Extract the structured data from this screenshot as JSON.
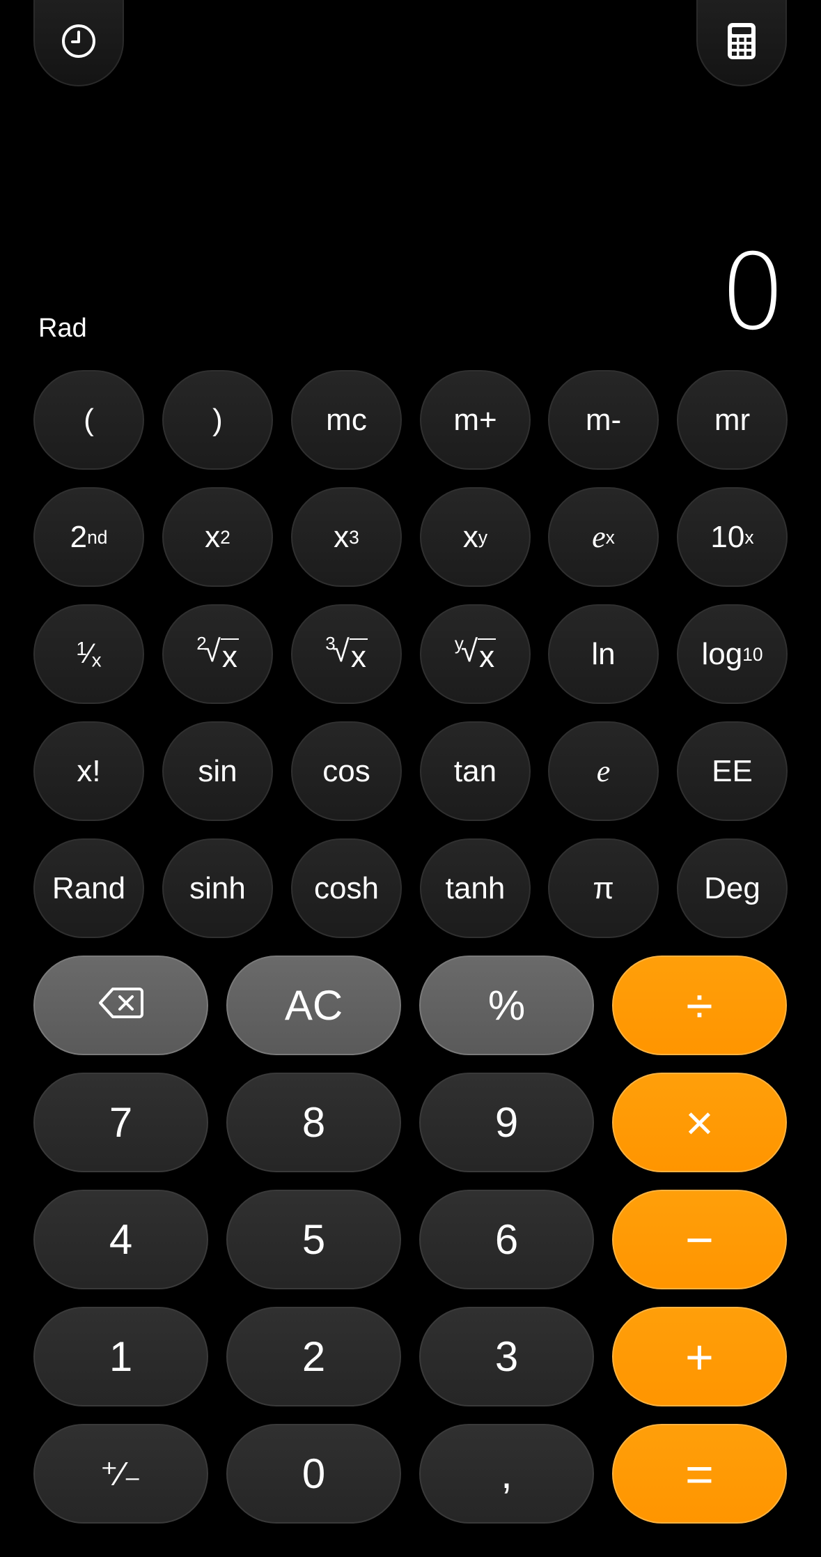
{
  "display": {
    "value": "0",
    "angle_mode": "Rad"
  },
  "top": {
    "history_icon": "clock-icon",
    "mode_icon": "calculator-icon"
  },
  "scientific": {
    "row1": [
      "(",
      ")",
      "mc",
      "m+",
      "m-",
      "mr"
    ],
    "row2": {
      "second": "2",
      "second_sup": "nd",
      "x": "x",
      "x2_sup": "2",
      "x3_sup": "3",
      "xy_sup": "y",
      "e": "e",
      "ex_sup": "x",
      "ten": "10",
      "tenx_sup": "x"
    },
    "row3": {
      "reciprocal": "⅟",
      "reciprocal_x": "x",
      "sqrt2_idx": "2",
      "sqrt3_idx": "3",
      "sqrty_idx": "y",
      "radicand": "x",
      "ln": "ln",
      "log": "log",
      "log_sub": "10"
    },
    "row4": [
      "x!",
      "sin",
      "cos",
      "tan",
      "e",
      "EE"
    ],
    "row5": [
      "Rand",
      "sinh",
      "cosh",
      "tanh",
      "π",
      "Deg"
    ]
  },
  "standard": {
    "backspace_icon": "backspace-icon",
    "ac": "AC",
    "percent": "%",
    "divide": "÷",
    "digits": [
      "7",
      "8",
      "9",
      "4",
      "5",
      "6",
      "1",
      "2",
      "3"
    ],
    "multiply": "×",
    "minus": "−",
    "plus": "+",
    "plus_minus": "⁺∕₋",
    "zero": "0",
    "decimal": ",",
    "equals": "="
  },
  "colors": {
    "operator": "#ff9500",
    "function": "#5a5a5a",
    "number": "#2a2a2a",
    "background": "#000000"
  }
}
